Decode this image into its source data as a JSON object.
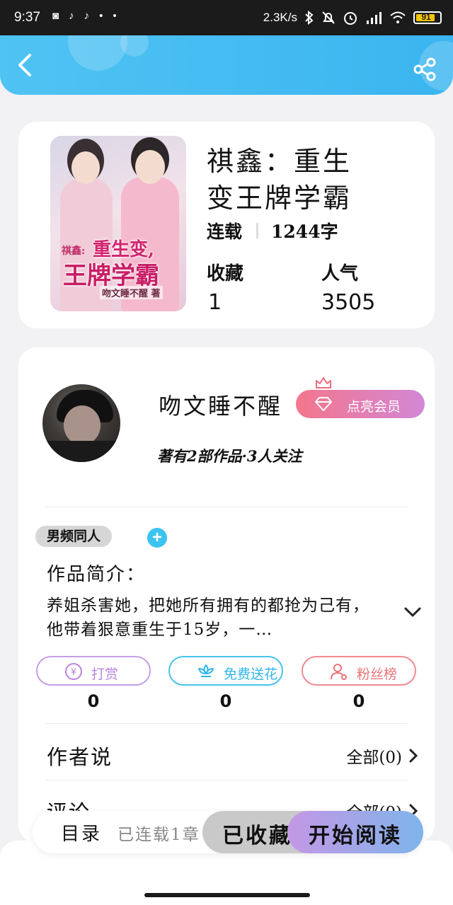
{
  "status_bar": {
    "time": "9:37",
    "notification_icons": [
      "weibo-icon",
      "tiktok-icon",
      "tiktok-icon",
      "more-dots-icon"
    ],
    "net_speed": "2.3K/s",
    "battery_level": "91",
    "battery_color": "#f4c400"
  },
  "header": {
    "accent": "#3bb5f0"
  },
  "book": {
    "title": "祺鑫：重生变王牌学霸",
    "status": "连载",
    "word_count": "1244字",
    "favorites_label": "收藏",
    "favorites_value": "1",
    "popularity_label": "人气",
    "popularity_value": "3505",
    "cover": {
      "title_small": "祺鑫:",
      "title_line1": "重生变,",
      "title_line2": "王牌学霸",
      "author_line": "吻文睡不醒 著"
    }
  },
  "author": {
    "name": "吻文睡不醒",
    "vip_button": "点亮会员",
    "stats": "著有2部作品·3人关注"
  },
  "tags": [
    "男频同人"
  ],
  "intro": {
    "heading": "作品简介：",
    "text": "养姐杀害她，把她所有拥有的都抢为己有，他带着狠意重生于15岁，一…"
  },
  "actions": [
    {
      "label": "打赏",
      "count": "0",
      "color": "#b884e0"
    },
    {
      "label": "免费送花",
      "count": "0",
      "color": "#2fb6e8"
    },
    {
      "label": "粉丝榜",
      "count": "0",
      "color": "#ea7378"
    }
  ],
  "sections": {
    "author_says": {
      "label": "作者说",
      "link": "全部(0)"
    },
    "comments": {
      "label": "评论",
      "link": "全部(0)"
    }
  },
  "bottom_bar": {
    "toc": "目录",
    "serial_status": "已连载1章",
    "favorited": "已收藏",
    "start_reading": "开始阅读"
  }
}
